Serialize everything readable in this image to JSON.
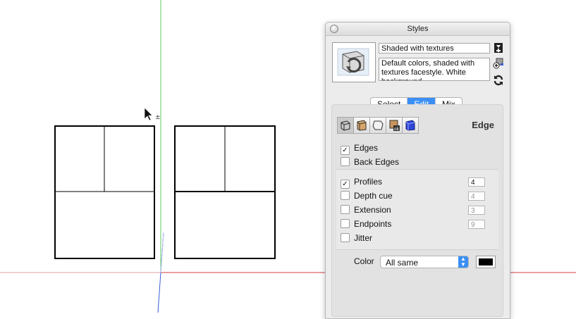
{
  "panel": {
    "title": "Styles",
    "style_name": "Shaded with textures",
    "style_description": "Default colors, shaded with textures facestyle. White background",
    "tabs": [
      {
        "label": "Select",
        "active": false
      },
      {
        "label": "Edit",
        "active": true
      },
      {
        "label": "Mix",
        "active": false
      }
    ],
    "section_label": "Edge",
    "settings_tabs": [
      "edge-settings-icon",
      "face-settings-icon",
      "background-settings-icon",
      "watermark-settings-icon",
      "modeling-settings-icon"
    ],
    "edges": {
      "label": "Edges",
      "checked": true
    },
    "back_edges": {
      "label": "Back Edges",
      "checked": false
    },
    "profiles": {
      "label": "Profiles",
      "checked": true,
      "value": "4"
    },
    "depth_cue": {
      "label": "Depth cue",
      "checked": false,
      "value": "4"
    },
    "extension": {
      "label": "Extension",
      "checked": false,
      "value": "3"
    },
    "endpoints": {
      "label": "Endpoints",
      "checked": false,
      "value": "9"
    },
    "jitter": {
      "label": "Jitter",
      "checked": false
    },
    "color": {
      "label": "Color",
      "value": "All same",
      "swatch": "#000000"
    }
  },
  "colors": {
    "accent": "#3a8ff5",
    "green_axis": "#5ec85e",
    "red_axis": "#d04040",
    "blue_axis": "#3a5fd8"
  }
}
